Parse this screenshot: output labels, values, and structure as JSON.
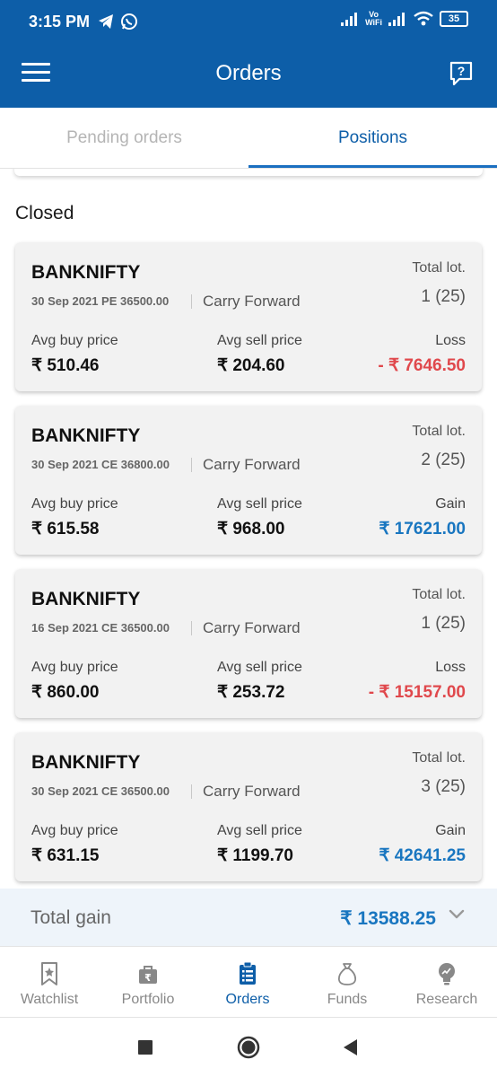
{
  "status_bar": {
    "time": "3:15 PM",
    "battery": "35",
    "vowifi_top": "Vo",
    "vowifi_bottom": "WiFi"
  },
  "app_bar": {
    "title": "Orders"
  },
  "tabs": [
    {
      "label": "Pending orders",
      "active": false
    },
    {
      "label": "Positions",
      "active": true
    }
  ],
  "section_title": "Closed",
  "positions": [
    {
      "symbol": "BANKNIFTY",
      "contract": "30 Sep 2021 PE 36500.00",
      "product": "Carry Forward",
      "lot_label": "Total lot.",
      "lot_value": "1 (25)",
      "buy_label": "Avg buy price",
      "buy_value": "₹ 510.46",
      "sell_label": "Avg sell price",
      "sell_value": "₹ 204.60",
      "pl_label": "Loss",
      "pl_value": "- ₹ 7646.50",
      "pl_type": "loss"
    },
    {
      "symbol": "BANKNIFTY",
      "contract": "30 Sep 2021 CE 36800.00",
      "product": "Carry Forward",
      "lot_label": "Total lot.",
      "lot_value": "2 (25)",
      "buy_label": "Avg buy price",
      "buy_value": "₹ 615.58",
      "sell_label": "Avg sell price",
      "sell_value": "₹ 968.00",
      "pl_label": "Gain",
      "pl_value": "₹ 17621.00",
      "pl_type": "gain"
    },
    {
      "symbol": "BANKNIFTY",
      "contract": "16 Sep 2021 CE 36500.00",
      "product": "Carry Forward",
      "lot_label": "Total lot.",
      "lot_value": "1 (25)",
      "buy_label": "Avg buy price",
      "buy_value": "₹ 860.00",
      "sell_label": "Avg sell price",
      "sell_value": "₹ 253.72",
      "pl_label": "Loss",
      "pl_value": "- ₹ 15157.00",
      "pl_type": "loss"
    },
    {
      "symbol": "BANKNIFTY",
      "contract": "30 Sep 2021 CE 36500.00",
      "product": "Carry Forward",
      "lot_label": "Total lot.",
      "lot_value": "3 (25)",
      "buy_label": "Avg buy price",
      "buy_value": "₹ 631.15",
      "sell_label": "Avg sell price",
      "sell_value": "₹ 1199.70",
      "pl_label": "Gain",
      "pl_value": "₹ 42641.25",
      "pl_type": "gain"
    }
  ],
  "total": {
    "label": "Total gain",
    "value": "₹ 13588.25"
  },
  "bottom_nav": [
    {
      "label": "Watchlist",
      "icon": "bookmark-star-icon",
      "active": false
    },
    {
      "label": "Portfolio",
      "icon": "briefcase-rupee-icon",
      "active": false
    },
    {
      "label": "Orders",
      "icon": "clipboard-list-icon",
      "active": true
    },
    {
      "label": "Funds",
      "icon": "money-bag-icon",
      "active": false
    },
    {
      "label": "Research",
      "icon": "lightbulb-icon",
      "active": false
    }
  ],
  "colors": {
    "primary": "#0d5ea8",
    "gain": "#1976c0",
    "loss": "#e0484c"
  }
}
